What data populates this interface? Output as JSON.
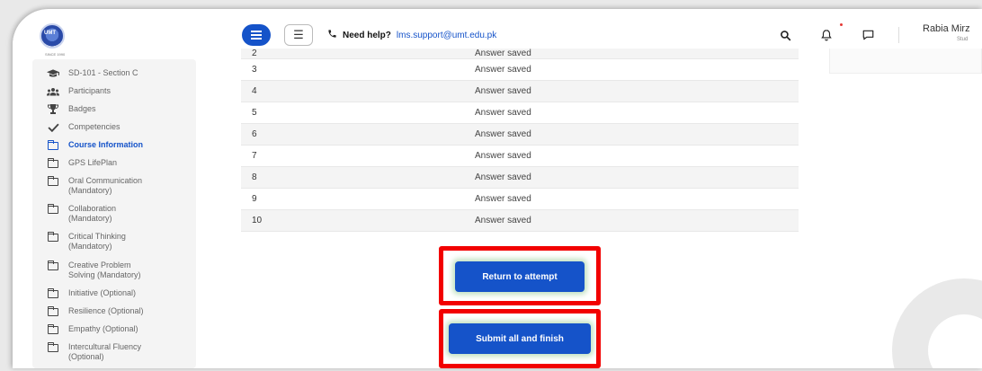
{
  "navbar": {
    "logo_text": "UMT",
    "logo_sub": "SINCE 1990",
    "help_label": "Need help?",
    "help_email": "lms.support@umt.edu.pk",
    "user_name": "Rabia Mirz",
    "user_role": "Stud"
  },
  "sidebar": {
    "items": [
      {
        "label": "SD-101 - Section C",
        "icon": "graduation-cap-icon"
      },
      {
        "label": "Participants",
        "icon": "users-icon"
      },
      {
        "label": "Badges",
        "icon": "trophy-icon"
      },
      {
        "label": "Competencies",
        "icon": "checkmark-icon"
      },
      {
        "label": "Course Information",
        "icon": "folder-icon",
        "active": true
      },
      {
        "label": "GPS LifePlan",
        "icon": "folder-icon"
      },
      {
        "label": "Oral Communication",
        "label2": "(Mandatory)",
        "icon": "folder-icon"
      },
      {
        "label": "Collaboration",
        "label2": "(Mandatory)",
        "icon": "folder-icon"
      },
      {
        "label": "Critical Thinking",
        "label2": "(Mandatory)",
        "icon": "folder-icon"
      },
      {
        "label": "Creative Problem",
        "label2": "Solving (Mandatory)",
        "icon": "folder-icon"
      },
      {
        "label": "Initiative (Optional)",
        "icon": "folder-icon"
      },
      {
        "label": "Resilience (Optional)",
        "icon": "folder-icon"
      },
      {
        "label": "Empathy (Optional)",
        "icon": "folder-icon"
      },
      {
        "label": "Intercultural Fluency",
        "label2": "(Optional)",
        "icon": "folder-icon"
      }
    ]
  },
  "summary": {
    "rows": [
      {
        "question": "2",
        "status": "Answer saved"
      },
      {
        "question": "3",
        "status": "Answer saved"
      },
      {
        "question": "4",
        "status": "Answer saved"
      },
      {
        "question": "5",
        "status": "Answer saved"
      },
      {
        "question": "6",
        "status": "Answer saved"
      },
      {
        "question": "7",
        "status": "Answer saved"
      },
      {
        "question": "8",
        "status": "Answer saved"
      },
      {
        "question": "9",
        "status": "Answer saved"
      },
      {
        "question": "10",
        "status": "Answer saved"
      }
    ]
  },
  "actions": {
    "return_label": "Return to attempt",
    "submit_label": "Submit all and finish"
  },
  "colors": {
    "accent": "#1553c9",
    "highlight": "#f20000"
  }
}
